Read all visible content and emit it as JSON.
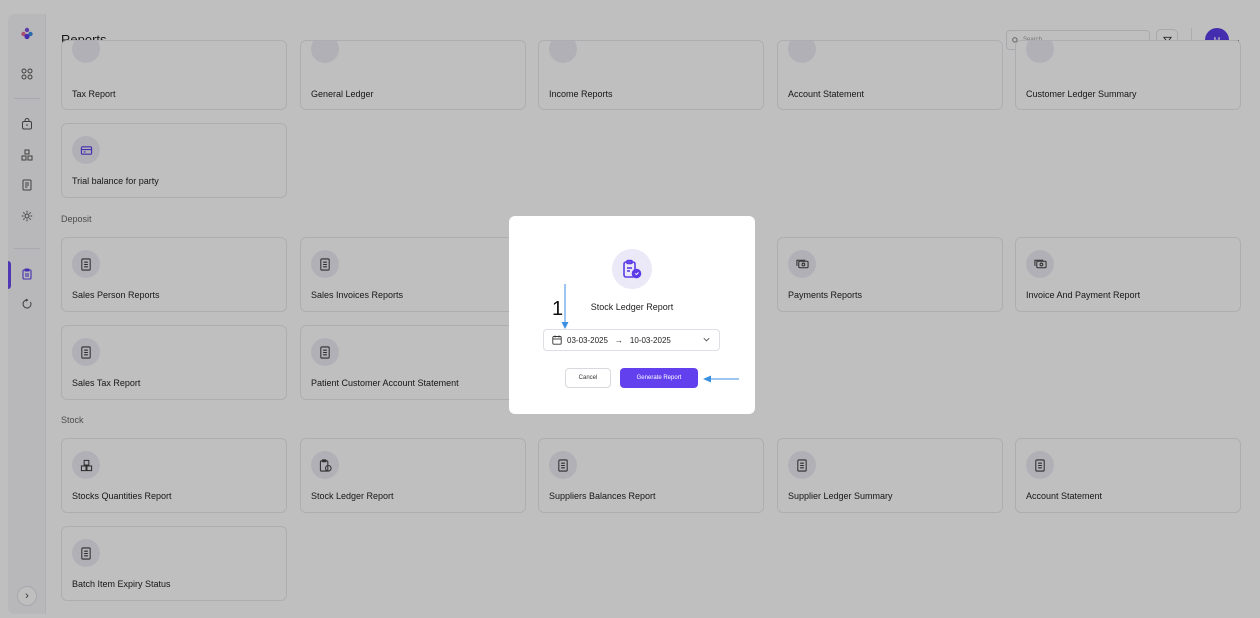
{
  "header": {
    "title": "Reports",
    "search_placeholder": "Search",
    "avatar_initial": "M"
  },
  "sections": {
    "deposit": "Deposit",
    "stock": "Stock"
  },
  "cards": {
    "row1": [
      "Tax Report",
      "General Ledger",
      "Income Reports",
      "Account Statement",
      "Customer Ledger Summary"
    ],
    "row2": [
      "Trial balance for party"
    ],
    "deposit_row1": [
      "Sales Person Reports",
      "Sales Invoices Reports",
      "Payments Reports",
      "Invoice And Payment Report"
    ],
    "deposit_row2": [
      "Sales Tax Report",
      "Patient Customer Account Statement"
    ],
    "stock_row1": [
      "Stocks Quantities Report",
      "Stock Ledger Report",
      "Suppliers Balances Report",
      "Supplier Ledger Summary",
      "Account Statement"
    ],
    "stock_row2": [
      "Batch Item Expiry Status"
    ]
  },
  "modal": {
    "title": "Stock Ledger Report",
    "date_from": "03-03-2025",
    "date_arrow": "→",
    "date_to": "10-03-2025",
    "cancel_label": "Cancel",
    "generate_label": "Generate Report"
  },
  "annotation": {
    "step_number": "1"
  },
  "colors": {
    "accent": "#6340ee",
    "icon_bg": "#ecebf5",
    "overlay": "rgba(0,0,0,0.25)",
    "annotation_arrow": "#3b8fe0"
  }
}
